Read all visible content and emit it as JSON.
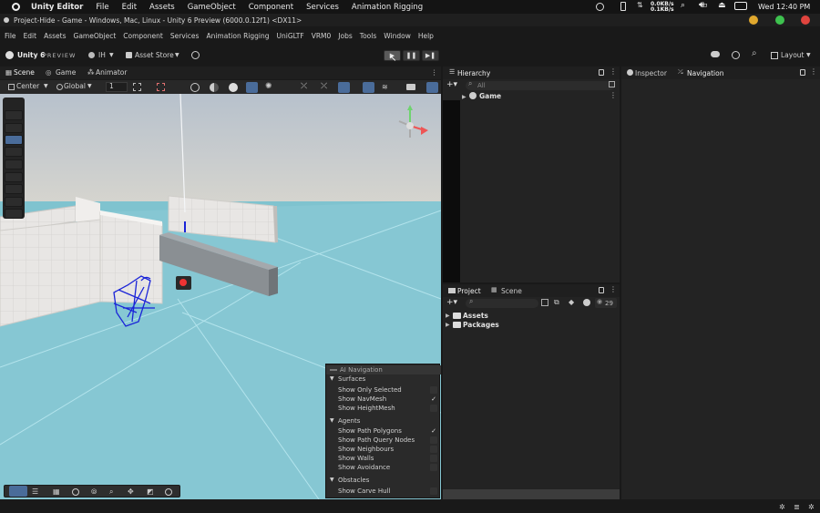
{
  "system_bar": {
    "app_name": "Unity Editor",
    "menus": [
      "File",
      "Edit",
      "Assets",
      "GameObject",
      "Component",
      "Services",
      "Animation Rigging"
    ],
    "net_up": "0.0KB/s",
    "net_down": "0.1KB/s",
    "clock": "Wed 12:40 PM",
    "window_controls": {
      "minimize_color": "#e0a82e",
      "maximize_color": "#3ec24f",
      "close_color": "#e0443e"
    }
  },
  "window": {
    "title": "Project-Hide - Game - Windows, Mac, Linux - Unity 6 Preview (6000.0.12f1) <DX11>"
  },
  "menu_bar": {
    "items": [
      "File",
      "Edit",
      "Assets",
      "GameObject",
      "Component",
      "Services",
      "Animation Rigging",
      "UniGLTF",
      "VRM0",
      "Jobs",
      "Tools",
      "Window",
      "Help"
    ]
  },
  "toolbar": {
    "brand": "Unity 6",
    "brand_tag": "PREVIEW",
    "account": "IH",
    "asset_store": "Asset Store",
    "layout": "Layout"
  },
  "scene_tabs": {
    "tabs": [
      "Scene",
      "Game",
      "Animator"
    ]
  },
  "scene_toolbar": {
    "pivot": "Center",
    "space": "Global",
    "grid_value": "1"
  },
  "hierarchy": {
    "title": "Hierarchy",
    "search_placeholder": "All",
    "root": "Game"
  },
  "inspector_tabs": {
    "tabs": [
      "Inspector",
      "Navigation"
    ]
  },
  "project": {
    "tabs": [
      "Project",
      "Scene"
    ],
    "count": "29",
    "folders": [
      "Assets",
      "Packages"
    ]
  },
  "ai_navigation": {
    "title": "AI Navigation",
    "sections": [
      {
        "label": "Surfaces",
        "items": [
          {
            "label": "Show Only Selected",
            "checked": false
          },
          {
            "label": "Show NavMesh",
            "checked": true
          },
          {
            "label": "Show HeightMesh",
            "checked": false
          }
        ]
      },
      {
        "label": "Agents",
        "items": [
          {
            "label": "Show Path Polygons",
            "checked": true
          },
          {
            "label": "Show Path Query Nodes",
            "checked": false
          },
          {
            "label": "Show Neighbours",
            "checked": false
          },
          {
            "label": "Show Walls",
            "checked": false
          },
          {
            "label": "Show Avoidance",
            "checked": false
          }
        ]
      },
      {
        "label": "Obstacles",
        "items": [
          {
            "label": "Show Carve Hull",
            "checked": false
          }
        ]
      }
    ]
  },
  "icons": [
    "unity-logo",
    "cloud-icon",
    "history-icon",
    "search-icon",
    "play-icon",
    "pause-icon",
    "step-icon",
    "gear-icon",
    "lock-icon",
    "more-icon"
  ],
  "colors": {
    "ground": "#7fc3cf",
    "navmesh_agent": "#1a24d8",
    "sky_top": "#b7c1cc"
  }
}
